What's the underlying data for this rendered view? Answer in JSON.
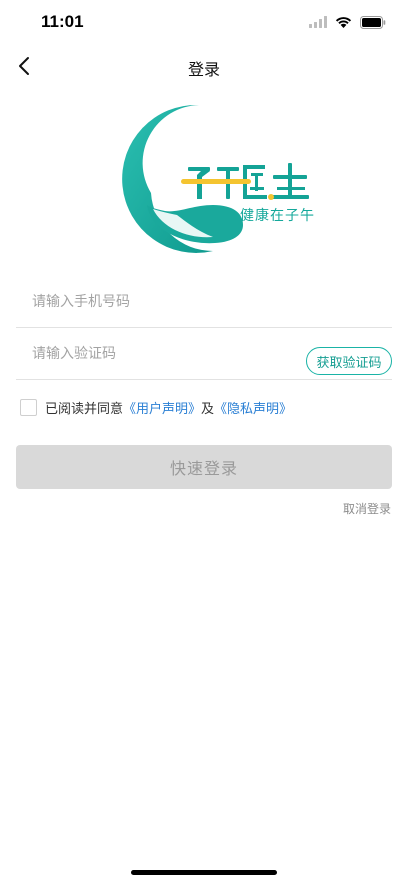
{
  "status_bar": {
    "time": "11:01",
    "icons": [
      "signal-icon",
      "wifi-icon",
      "battery-icon"
    ]
  },
  "nav": {
    "title": "登录",
    "back_icon": "chevron-left-icon"
  },
  "logo": {
    "brand_text": "子午医生",
    "slogan": "健康在子午",
    "colors": {
      "teal": "#15a89b",
      "teal_light": "#5fd0c4",
      "yellow": "#f4c430"
    }
  },
  "form": {
    "phone_placeholder": "请输入手机号码",
    "code_placeholder": "请输入验证码",
    "get_code_label": "获取验证码"
  },
  "agreement": {
    "prefix": "已阅读并同意",
    "user_terms": "《用户声明》",
    "conjunction": "及",
    "privacy_terms": "《隐私声明》",
    "checked": false
  },
  "actions": {
    "login_label": "快速登录",
    "cancel_label": "取消登录"
  }
}
